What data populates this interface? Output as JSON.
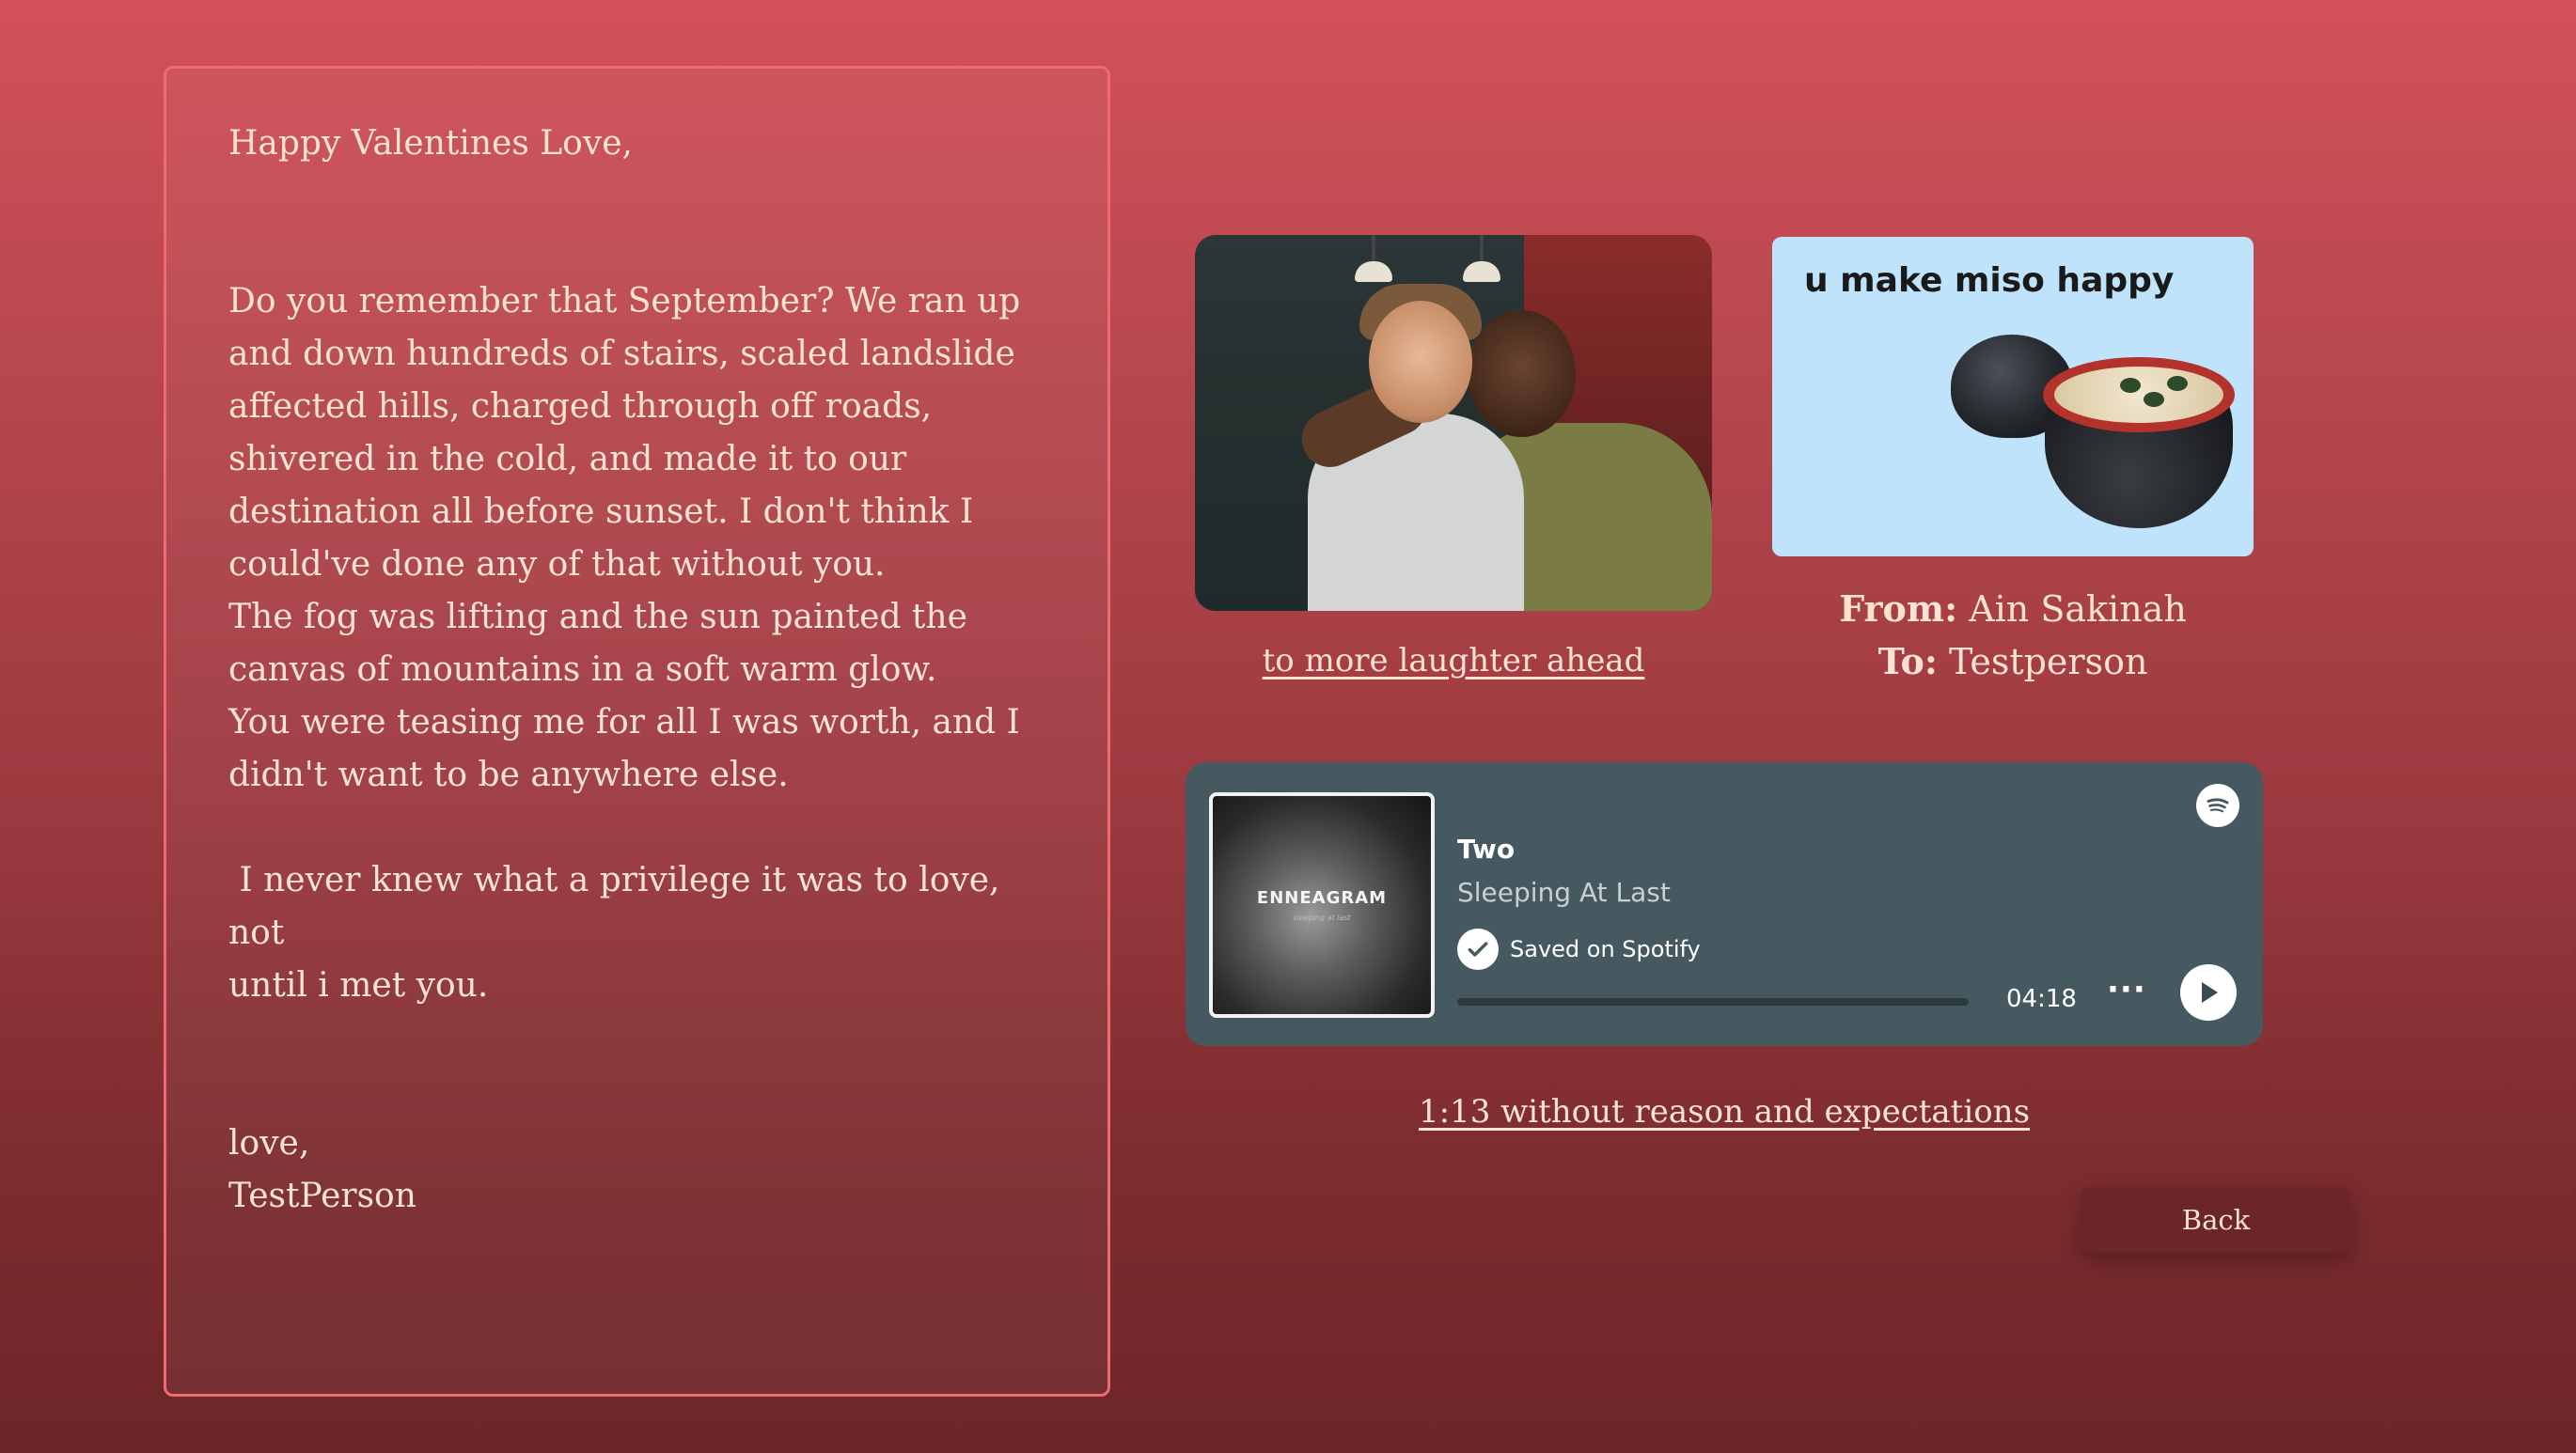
{
  "letter": {
    "greeting": "Happy Valentines Love,",
    "body1": "Do you remember that September? We ran up\nand down hundreds of stairs, scaled landslide\naffected hills, charged through off roads,\nshivered in the cold, and made it to our\ndestination all before sunset. I don't think I\ncould've done any of that without you.\nThe fog was lifting and the sun painted the\ncanvas of mountains in a soft warm glow.\nYou were teasing me for all I was worth, and I\ndidn't want to be anywhere else.",
    "body2": " I never knew what a privilege it was to love, not\nuntil i met you.",
    "signoff": "love,",
    "signature": "TestPerson"
  },
  "photo": {
    "caption_link": "to more laughter ahead"
  },
  "miso_card": {
    "text": "u make miso happy"
  },
  "fromto": {
    "from_label": "From:",
    "from_value": " Ain Sakinah",
    "to_label": "To:",
    "to_value": " Testperson"
  },
  "player": {
    "cover_title": "ENNEAGRAM",
    "cover_subtitle": "sleeping at last",
    "track_title": "Two",
    "artist": "Sleeping At Last",
    "saved_label": "Saved on Spotify",
    "duration": "04:18",
    "more_label": "···",
    "progress": 0,
    "icons": {
      "check": "check-icon",
      "play": "play-icon",
      "spotify": "spotify-logo-icon"
    }
  },
  "quote_link": "1:13 without reason and expectations",
  "back_button": "Back",
  "colors": {
    "accent_border": "#ef6b6f",
    "text": "#f7e3cf",
    "player_bg": "#465961",
    "back_bg": "#6c2528"
  }
}
